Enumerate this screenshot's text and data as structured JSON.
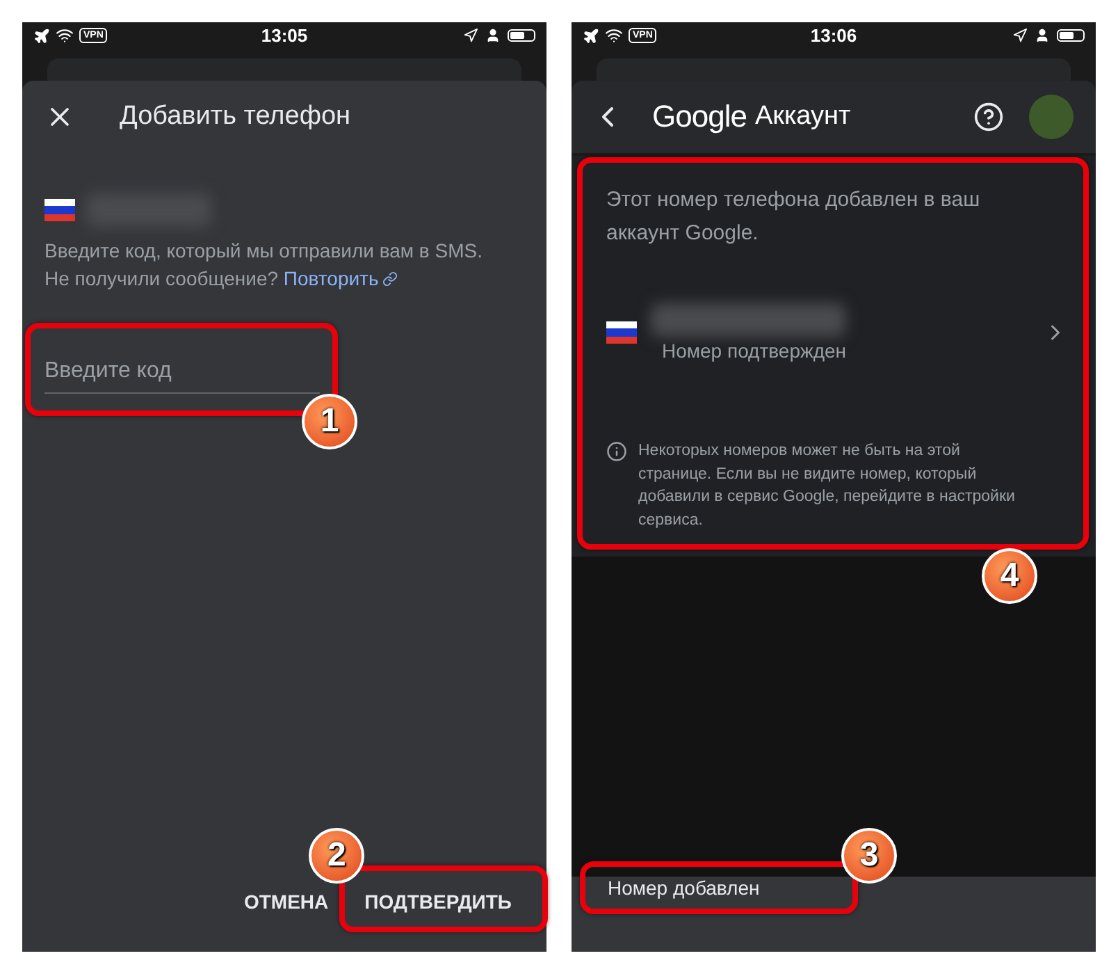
{
  "add_phone_screen": {
    "status_bar": {
      "vpn": "VPN",
      "time": "13:05"
    },
    "title": "Добавить телефон",
    "instructions": "Введите код, который мы отправили вам в SMS.",
    "resend_prompt": "Не получили сообщение?",
    "resend_link": "Повторить",
    "code_field": {
      "placeholder": "Введите код",
      "callout": "1"
    },
    "buttons": [
      {
        "label": "ОТМЕНА"
      },
      {
        "label": "ПОДТВЕРДИТЬ",
        "callout": "2"
      }
    ]
  },
  "account_screen": {
    "status_bar": {
      "vpn": "VPN",
      "time": "13:06"
    },
    "brand": "Google",
    "title": "Аккаунт",
    "card": {
      "message": "Этот номер телефона добавлен в ваш аккаунт Google.",
      "phone_status": "Номер подтвержден",
      "note": "Некоторых номеров может не быть на этой странице. Если вы не видите номер, который добавили в сервис Google, перейдите в настройки сервиса.",
      "callout": "4"
    },
    "snackbar": {
      "text": "Номер добавлен",
      "callout": "3"
    }
  }
}
